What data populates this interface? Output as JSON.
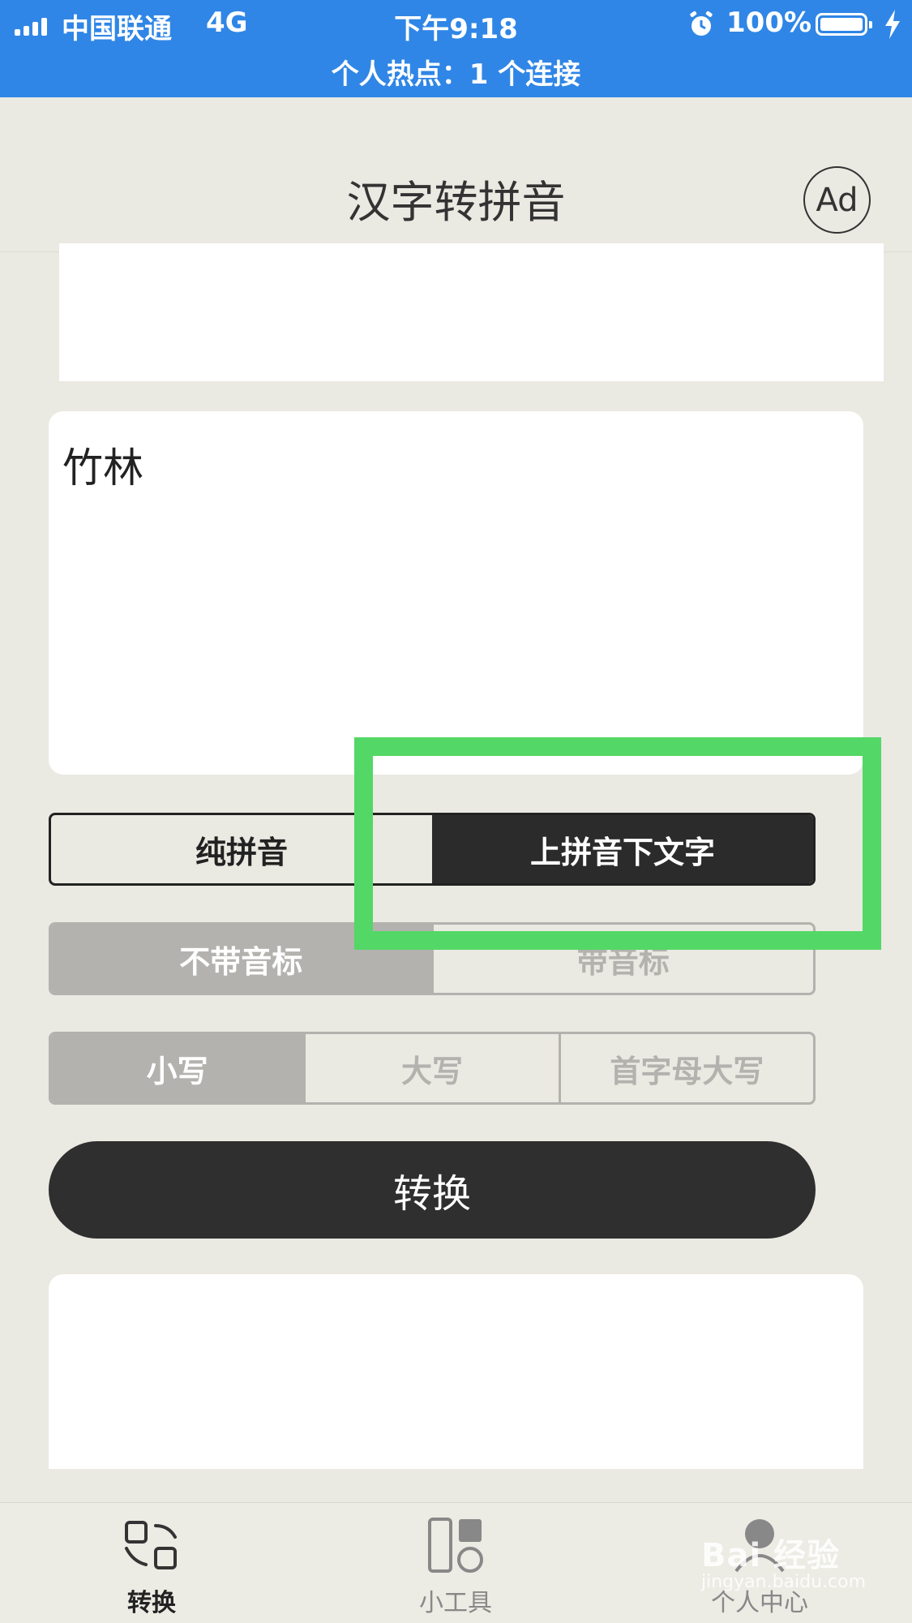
{
  "status_bar": {
    "carrier": "中国联通",
    "network": "4G",
    "time": "下午9:18",
    "battery": "100%",
    "hotspot": "个人热点：1 个连接"
  },
  "header": {
    "title": "汉字转拼音",
    "ad_label": "Ad"
  },
  "input": {
    "text": "竹林"
  },
  "mode_options": [
    "纯拼音",
    "上拼音下文字"
  ],
  "mode_selected": 1,
  "tone_options": [
    "不带音标",
    "带音标"
  ],
  "tone_selected": 0,
  "case_options": [
    "小写",
    "大写",
    "首字母大写"
  ],
  "case_selected": 0,
  "convert_label": "转换",
  "tabbar": {
    "tabs": [
      {
        "label": "转换",
        "icon": "convert-icon",
        "active": true
      },
      {
        "label": "小工具",
        "icon": "tools-icon",
        "active": false
      },
      {
        "label": "个人中心",
        "icon": "profile-icon",
        "active": false
      }
    ]
  },
  "watermark": {
    "main": "Bai 经验",
    "sub": "jingyan.baidu.com"
  },
  "colors": {
    "status_bar": "#2f86e6",
    "background": "#eae9e2",
    "dark": "#2b2b2b",
    "muted": "#b4b2ae",
    "highlight": "#53d766"
  }
}
